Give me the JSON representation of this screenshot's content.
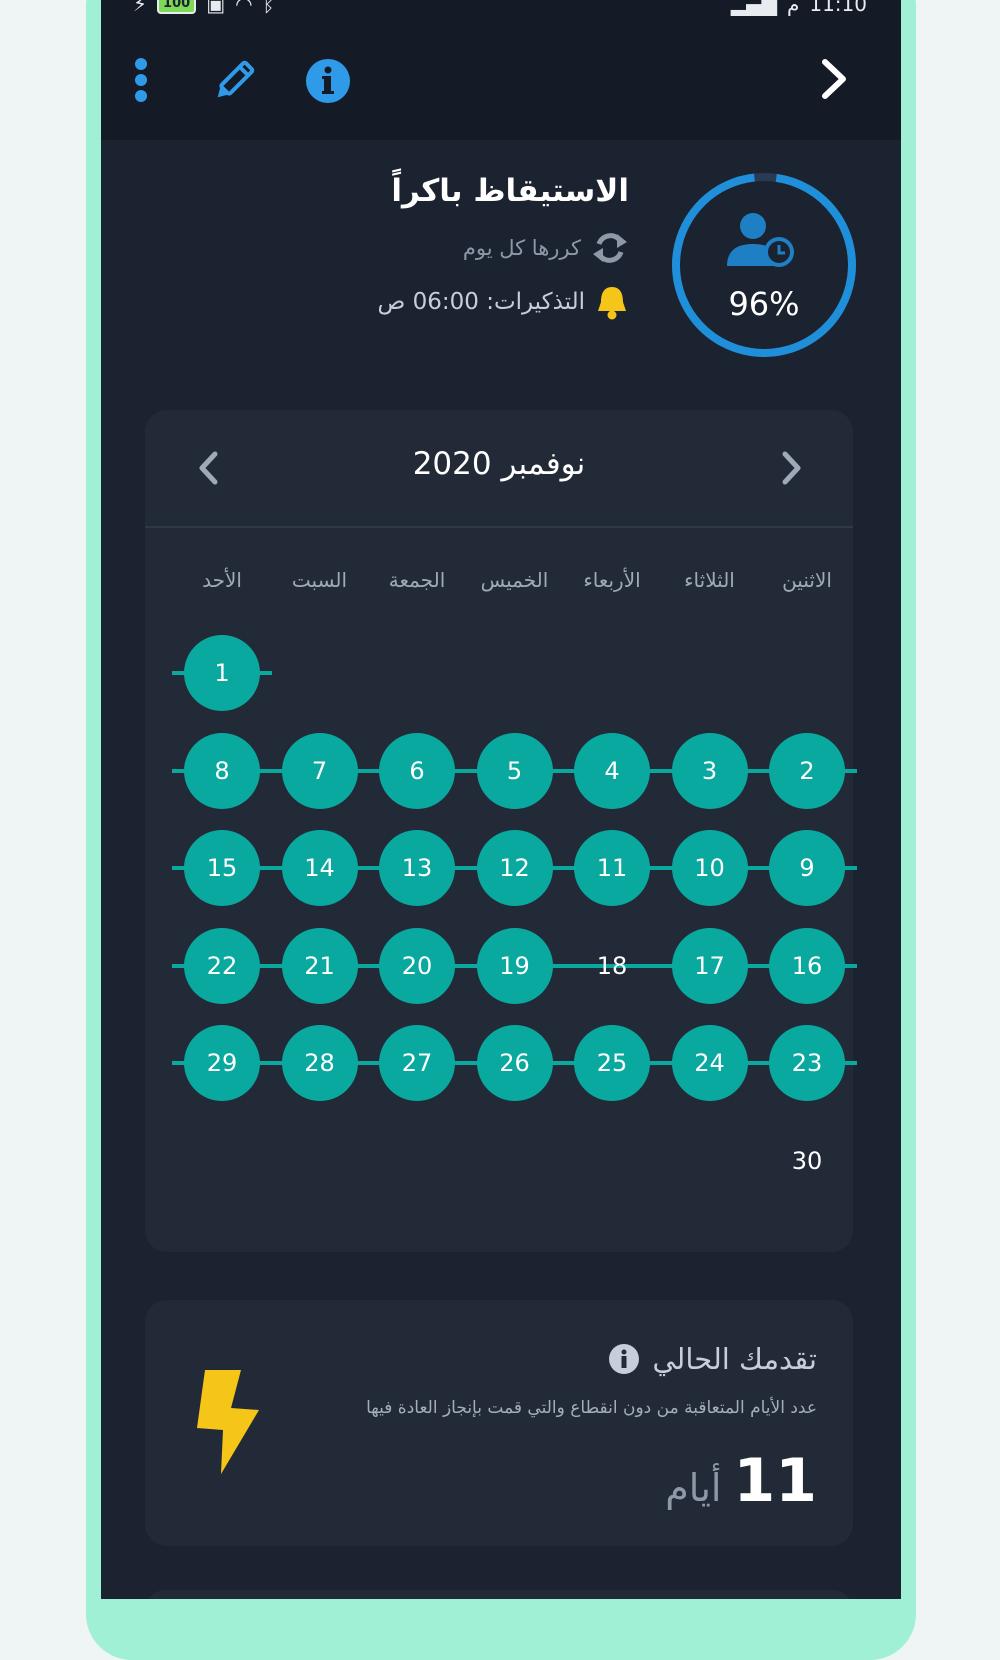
{
  "status": {
    "battery": "100",
    "time": "11:10",
    "time_suffix": "م"
  },
  "habit": {
    "title": "الاستيقاظ باكراً",
    "repeat": "كررها كل يوم",
    "reminder": "التذكيرات: 06:00 ص",
    "percent": "96%",
    "progress_fraction": 0.96
  },
  "calendar": {
    "month_label": "نوفمبر 2020",
    "weekdays": [
      "الاثنين",
      "الثلاثاء",
      "الأربعاء",
      "الخميس",
      "الجمعة",
      "السبت",
      "الأحد"
    ],
    "weeks": [
      [
        null,
        null,
        null,
        null,
        null,
        null,
        {
          "day": "1",
          "done": true
        }
      ],
      [
        {
          "day": "2",
          "done": true
        },
        {
          "day": "3",
          "done": true
        },
        {
          "day": "4",
          "done": true
        },
        {
          "day": "5",
          "done": true
        },
        {
          "day": "6",
          "done": true
        },
        {
          "day": "7",
          "done": true
        },
        {
          "day": "8",
          "done": true
        }
      ],
      [
        {
          "day": "9",
          "done": true
        },
        {
          "day": "10",
          "done": true
        },
        {
          "day": "11",
          "done": true
        },
        {
          "day": "12",
          "done": true
        },
        {
          "day": "13",
          "done": true
        },
        {
          "day": "14",
          "done": true
        },
        {
          "day": "15",
          "done": true
        }
      ],
      [
        {
          "day": "16",
          "done": true
        },
        {
          "day": "17",
          "done": true
        },
        {
          "day": "18",
          "done": false
        },
        {
          "day": "19",
          "done": true
        },
        {
          "day": "20",
          "done": true
        },
        {
          "day": "21",
          "done": true
        },
        {
          "day": "22",
          "done": true
        }
      ],
      [
        {
          "day": "23",
          "done": true
        },
        {
          "day": "24",
          "done": true
        },
        {
          "day": "25",
          "done": true
        },
        {
          "day": "26",
          "done": true
        },
        {
          "day": "27",
          "done": true
        },
        {
          "day": "28",
          "done": true
        },
        {
          "day": "29",
          "done": true
        }
      ],
      [
        {
          "day": "30",
          "done": false
        },
        null,
        null,
        null,
        null,
        null,
        null
      ]
    ]
  },
  "progress": {
    "title": "تقدمك الحالي",
    "description": "عدد الأيام المتعاقبة من دون انقطاع والتي قمت بإنجاز العادة فيها",
    "count": "11",
    "unit": "أيام"
  },
  "colors": {
    "accent": "#0aa9a0",
    "ring": "#1e8fd8",
    "bolt": "#f5c518",
    "bell": "#f5c518"
  }
}
